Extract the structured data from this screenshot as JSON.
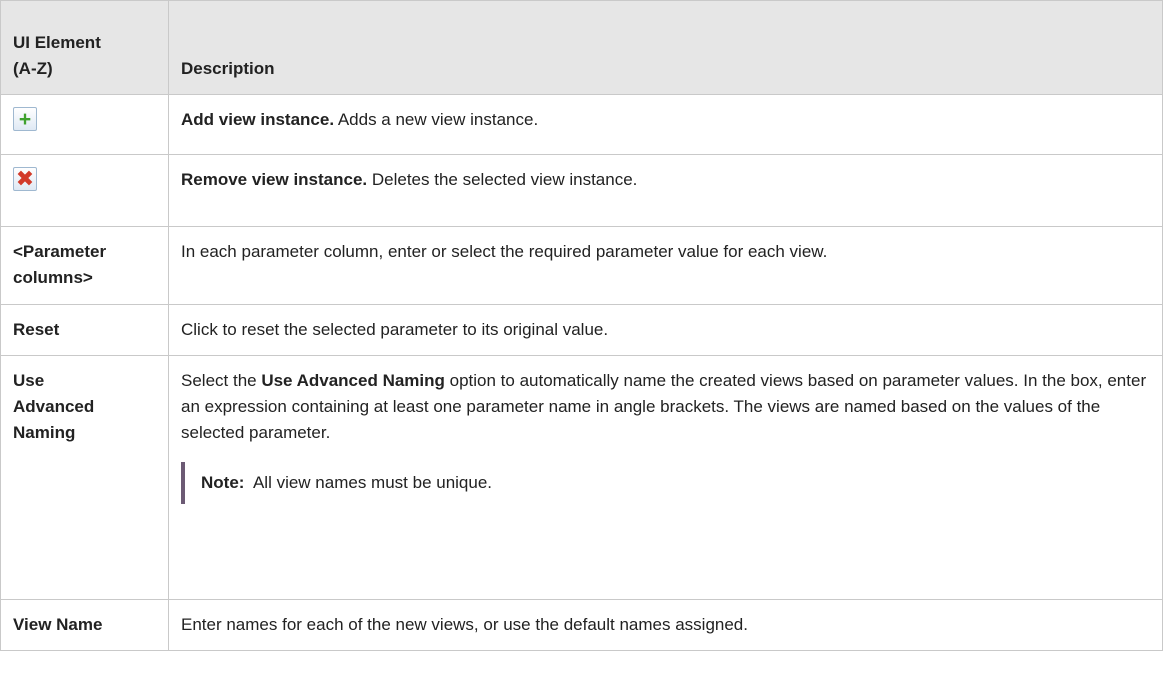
{
  "headers": {
    "element_line1": "UI Element",
    "element_line2": "(A-Z)",
    "description": "Description"
  },
  "rows": {
    "add": {
      "icon": "add-icon",
      "title": "Add view instance.",
      "text": " Adds a new view instance."
    },
    "remove": {
      "icon": "remove-icon",
      "title": "Remove view instance.",
      "text": " Deletes the selected view instance."
    },
    "params": {
      "element_line1": "<Parameter",
      "element_line2": "columns>",
      "text": "In each parameter column, enter or select the required parameter value for each view."
    },
    "reset": {
      "element": "Reset",
      "text": "Click to reset the selected parameter to its original value."
    },
    "naming": {
      "element_line1": "Use",
      "element_line2": "Advanced",
      "element_line3": "Naming",
      "text_before": "Select the ",
      "text_bold": "Use Advanced Naming",
      "text_after": " option to automatically name the created views based on parameter values. In the box, enter an expression containing at least one parameter name in angle brackets. The views are named based on the values of the selected parameter.",
      "note_label": "Note:",
      "note_text": "  All view names must be unique."
    },
    "viewname": {
      "element": "View Name",
      "text": "Enter names for each of the new views, or use the default names assigned."
    }
  },
  "colors": {
    "header_bg": "#e6e6e6",
    "border": "#c9c9c9",
    "note_bar": "#6c5a74"
  }
}
